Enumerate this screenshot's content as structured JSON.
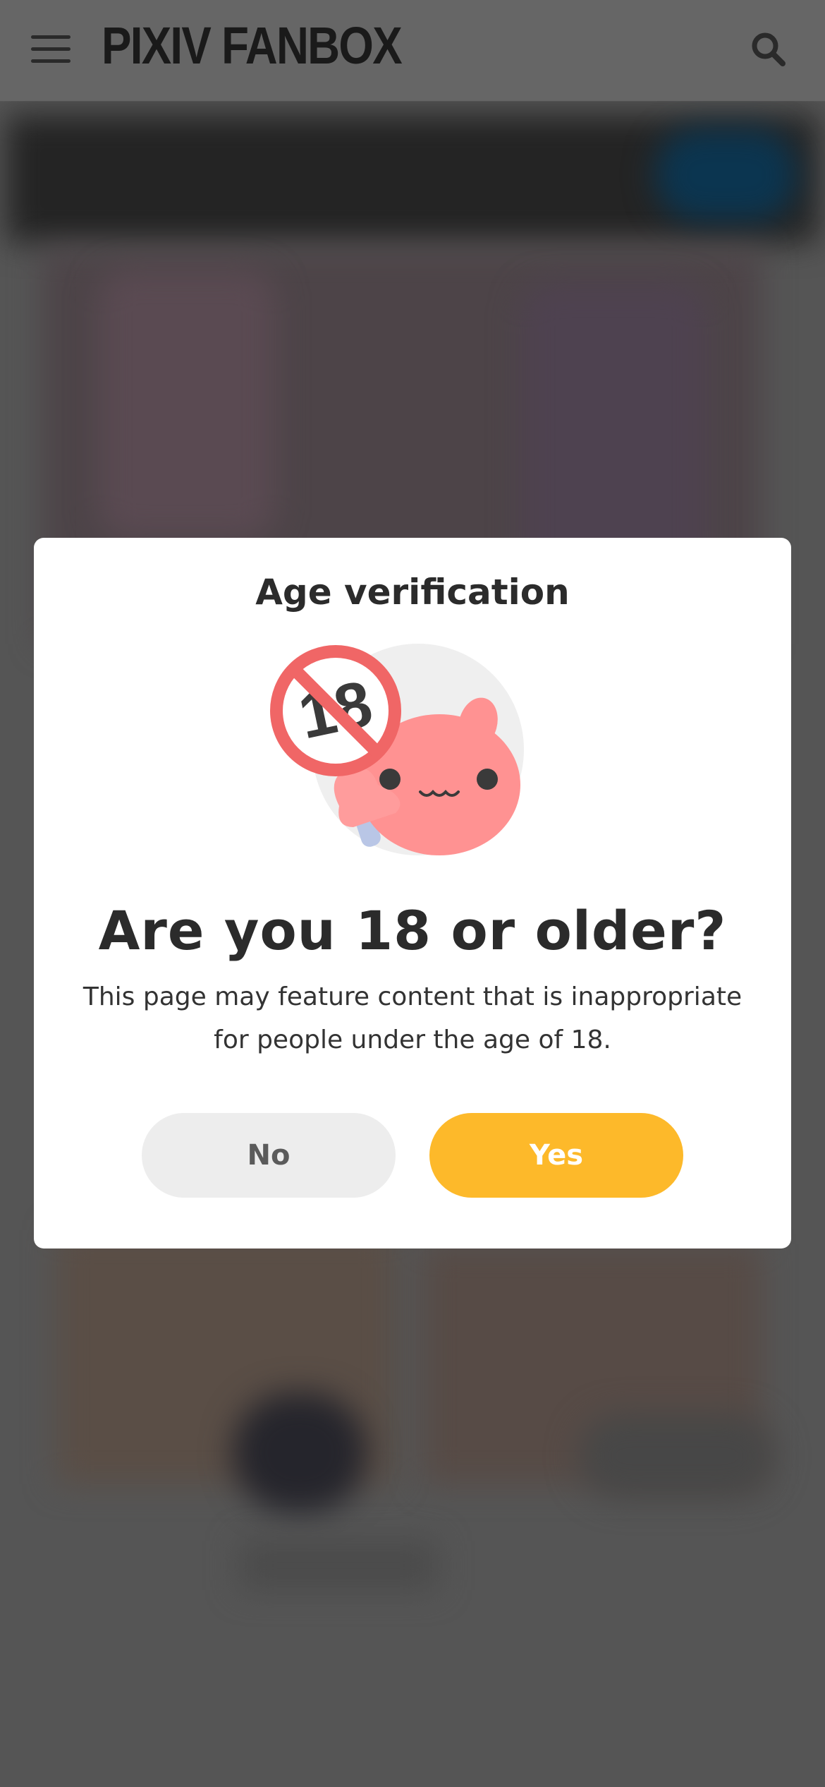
{
  "header": {
    "logo_text": "PIXIV FANBOX",
    "menu_icon": "hamburger-menu-icon",
    "search_icon": "search-icon"
  },
  "dialog": {
    "title": "Age verification",
    "illustration": "age-restriction-mascot",
    "question": "Are you 18 or older?",
    "description": "This page may feature content that is inappropriate for people under the age of 18.",
    "no_label": "No",
    "yes_label": "Yes",
    "sign_text": "18"
  },
  "colors": {
    "overlay": "#555555",
    "header": "#666666",
    "yes_button": "#fdb92a",
    "no_button": "#ededed",
    "text": "#2b2b2b"
  }
}
